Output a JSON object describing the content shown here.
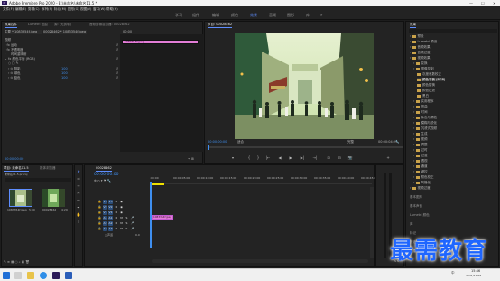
{
  "window": {
    "title": "Adobe Premiere Pro 2020 - E:\\未命名\\未命名11.5 *",
    "minimize": "—",
    "maximize": "☐",
    "close": "✕"
  },
  "menu": [
    "文件(F)",
    "编辑(E)",
    "剪辑(C)",
    "序列(S)",
    "标记(M)",
    "图形(G)",
    "视图(V)",
    "窗口(W)",
    "帮助(H)"
  ],
  "workspaces": {
    "items": [
      "学习",
      "组件",
      "编辑",
      "颜色",
      "效果",
      "音频",
      "图形",
      "库"
    ],
    "active_index": 4,
    "more": "»"
  },
  "effect_controls": {
    "tabs": [
      "效果控件",
      "Lumetri 范围",
      "源: (无剪辑)",
      "音频剪辑混合器: 00028462"
    ],
    "source": "主要 * 1083354f.jpeg",
    "seq": "00028462 * 1083354f.jpeg",
    "timecode_head": "00:00",
    "clip_name": "1083354f.jpeg",
    "video_label": "视频",
    "rows": [
      {
        "label": "运动"
      },
      {
        "label": "不透明度"
      },
      {
        "label": "时间重映射"
      },
      {
        "label": "颜色平衡 (RGB)"
      },
      {
        "label": "阴影",
        "value": "100"
      },
      {
        "label": "绿色",
        "value": "100"
      },
      {
        "label": "蓝色",
        "value": "100"
      }
    ],
    "timecode": "00:00:00:00"
  },
  "program": {
    "tab": "节目: 00028462",
    "timecode_left": "00:00:00:00",
    "fit": "适合",
    "quality": "完整",
    "timecode_right": "00:00:04:29",
    "controls": [
      "▾",
      "{",
      "}",
      "|←",
      "◀",
      "▶",
      "▶|",
      "→|",
      "⊡",
      "⊟",
      "📷",
      "+"
    ]
  },
  "effects_panel": {
    "title": "效果",
    "items": [
      {
        "label": "预设",
        "level": 0
      },
      {
        "label": "Lumetri 预设",
        "level": 0
      },
      {
        "label": "音频效果",
        "level": 0
      },
      {
        "label": "音频过渡",
        "level": 0
      },
      {
        "label": "视频效果",
        "level": 0
      },
      {
        "label": "变换",
        "level": 1
      },
      {
        "label": "图像控制",
        "level": 1
      },
      {
        "label": "灰度系数校正",
        "level": 2
      },
      {
        "label": "颜色平衡 (RGB)",
        "level": 2,
        "selected": true
      },
      {
        "label": "颜色替换",
        "level": 2
      },
      {
        "label": "颜色过滤",
        "level": 2
      },
      {
        "label": "黑白",
        "level": 2
      },
      {
        "label": "实用程序",
        "level": 1
      },
      {
        "label": "扭曲",
        "level": 1
      },
      {
        "label": "时间",
        "level": 1
      },
      {
        "label": "杂色与颗粒",
        "level": 1
      },
      {
        "label": "模糊与锐化",
        "level": 1
      },
      {
        "label": "沉浸式视频",
        "level": 1
      },
      {
        "label": "生成",
        "level": 1
      },
      {
        "label": "视频",
        "level": 1
      },
      {
        "label": "调整",
        "level": 1
      },
      {
        "label": "过时",
        "level": 1
      },
      {
        "label": "过渡",
        "level": 1
      },
      {
        "label": "透视",
        "level": 1
      },
      {
        "label": "通道",
        "level": 1
      },
      {
        "label": "键控",
        "level": 1
      },
      {
        "label": "颜色校正",
        "level": 1
      },
      {
        "label": "风格化",
        "level": 1
      },
      {
        "label": "视频过渡",
        "level": 0
      }
    ],
    "lower": [
      "基本图形",
      "基本声音",
      "Lumetri 颜色",
      "库",
      "标记",
      "历史记录",
      "信息"
    ]
  },
  "project": {
    "tabs": [
      "项目: 未命名11.5",
      "媒体浏览器",
      "库",
      "信息"
    ],
    "path": "未命名11.5.prproj",
    "items": [
      {
        "name": "1083354f.jpeg",
        "duration": "5:00"
      },
      {
        "name": "00028462",
        "duration": "4:29"
      }
    ]
  },
  "timeline": {
    "tab": "00028462",
    "timecode": "00:00:00:00",
    "ruler": [
      ":00:00",
      "00:00:05:00",
      "00:00:10:00",
      "00:00:15:00",
      "00:00:20:00",
      "00:00:25:00",
      "00:00:30:00",
      "00:00:35:00",
      "00:00:40:00",
      "00:00:45:00"
    ],
    "video_tracks": [
      "V3",
      "V2",
      "V1"
    ],
    "audio_tracks": [
      "A1",
      "A2",
      "A3"
    ],
    "master": {
      "label": "主声道",
      "value": "0.0"
    },
    "clip": "1083354f.jpeg"
  },
  "taskbar": {
    "time": "15:46",
    "date": "2021/11/16",
    "lang": "中"
  },
  "watermark": "最需教育",
  "colors": {
    "accent": "#5e8dff",
    "timecode": "#3f8ff0",
    "clip": "#e27dd6",
    "clip_border": "#c55bd2",
    "watermark": "#1f66ff"
  }
}
